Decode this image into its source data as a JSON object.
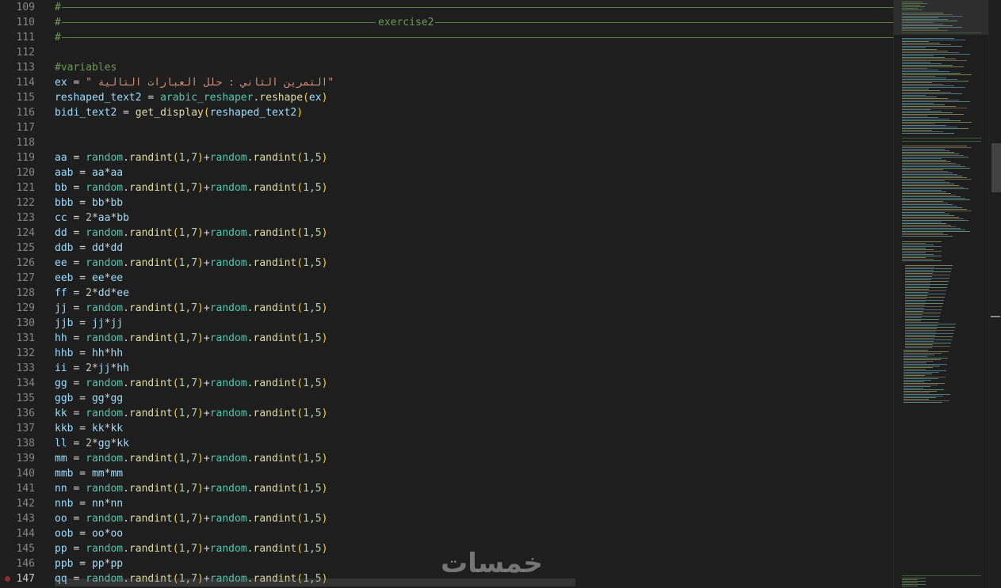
{
  "editor": {
    "lines": [
      {
        "n": "109",
        "parts": [
          {
            "c": "comment",
            "t": "#"
          }
        ],
        "guide": true
      },
      {
        "n": "110",
        "parts": [
          {
            "c": "comment",
            "t": "#"
          }
        ],
        "guide": true,
        "center_label": "exercise2"
      },
      {
        "n": "111",
        "parts": [
          {
            "c": "comment",
            "t": "#"
          }
        ],
        "guide": true
      },
      {
        "n": "112",
        "parts": []
      },
      {
        "n": "113",
        "parts": [
          {
            "c": "comment",
            "t": "#variables"
          }
        ]
      },
      {
        "n": "114",
        "parts": [
          {
            "c": "v",
            "t": "ex"
          },
          {
            "c": "o",
            "t": " = "
          },
          {
            "c": "s",
            "t": "\" التمرين الثاني : حلل العبارات التالية\""
          }
        ]
      },
      {
        "n": "115",
        "parts": [
          {
            "c": "v",
            "t": "reshaped_text2"
          },
          {
            "c": "o",
            "t": " = "
          },
          {
            "c": "m",
            "t": "arabic_reshaper"
          },
          {
            "c": "o",
            "t": "."
          },
          {
            "c": "f",
            "t": "reshape"
          },
          {
            "c": "p",
            "t": "("
          },
          {
            "c": "v",
            "t": "ex"
          },
          {
            "c": "p",
            "t": ")"
          }
        ]
      },
      {
        "n": "116",
        "parts": [
          {
            "c": "v",
            "t": "bidi_text2"
          },
          {
            "c": "o",
            "t": " = "
          },
          {
            "c": "f",
            "t": "get_display"
          },
          {
            "c": "p",
            "t": "("
          },
          {
            "c": "v",
            "t": "reshaped_text2"
          },
          {
            "c": "p",
            "t": ")"
          }
        ]
      },
      {
        "n": "117",
        "parts": []
      },
      {
        "n": "118",
        "parts": []
      },
      {
        "n": "119",
        "parts": "rand:aa"
      },
      {
        "n": "120",
        "parts": "sq:aab:aa"
      },
      {
        "n": "121",
        "parts": "rand:bb"
      },
      {
        "n": "122",
        "parts": "sq:bbb:bb"
      },
      {
        "n": "123",
        "parts": "dbl:cc:aa:bb"
      },
      {
        "n": "124",
        "parts": "rand:dd"
      },
      {
        "n": "125",
        "parts": "sq:ddb:dd"
      },
      {
        "n": "126",
        "parts": "rand:ee"
      },
      {
        "n": "127",
        "parts": "sq:eeb:ee"
      },
      {
        "n": "128",
        "parts": "dbl:ff:dd:ee"
      },
      {
        "n": "129",
        "parts": "rand:jj"
      },
      {
        "n": "130",
        "parts": "sq:jjb:jj"
      },
      {
        "n": "131",
        "parts": "rand:hh"
      },
      {
        "n": "132",
        "parts": "sq:hhb:hh"
      },
      {
        "n": "133",
        "parts": "dbl:ii:jj:hh"
      },
      {
        "n": "134",
        "parts": "rand:gg"
      },
      {
        "n": "135",
        "parts": "sq:ggb:gg"
      },
      {
        "n": "136",
        "parts": "rand:kk"
      },
      {
        "n": "137",
        "parts": "sq:kkb:kk"
      },
      {
        "n": "138",
        "parts": "dbl:ll:gg:kk"
      },
      {
        "n": "139",
        "parts": "rand:mm"
      },
      {
        "n": "140",
        "parts": "sq:mmb:mm"
      },
      {
        "n": "141",
        "parts": "rand:nn"
      },
      {
        "n": "142",
        "parts": "sq:nnb:nn"
      },
      {
        "n": "143",
        "parts": "rand:oo"
      },
      {
        "n": "144",
        "parts": "sq:oob:oo"
      },
      {
        "n": "145",
        "parts": "rand:pp"
      },
      {
        "n": "146",
        "parts": "sq:ppb:pp"
      },
      {
        "n": "147",
        "parts": "rand:qq",
        "breakpoint": true,
        "active": true
      }
    ],
    "rand_expr": {
      "module": "random",
      "func": "randint",
      "a": "1,7",
      "b": "1,5"
    }
  },
  "watermark": "خمسات",
  "colors": {
    "background": "#1e1e1e",
    "comment": "#6a9955",
    "variable": "#9cdcfe",
    "string": "#ce9178",
    "function": "#dcdcaa",
    "module": "#4ec9b0",
    "bracket": "#ffd700",
    "line_number": "#858585"
  }
}
